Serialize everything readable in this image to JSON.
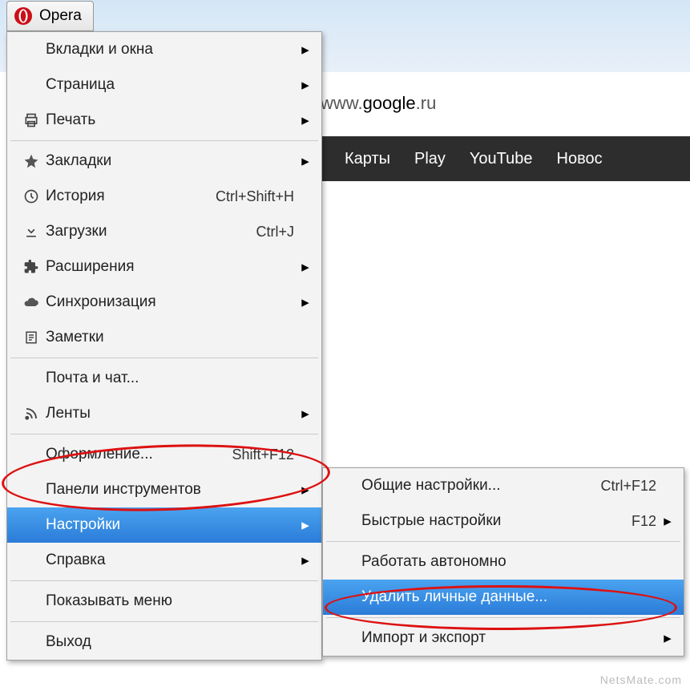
{
  "app": {
    "name": "Opera"
  },
  "address": {
    "prefix": "www.",
    "domain": "google",
    "suffix": ".ru"
  },
  "nav": {
    "items": [
      "Карты",
      "Play",
      "YouTube",
      "Новос"
    ]
  },
  "mainMenu": {
    "items": [
      {
        "icon": "",
        "label": "Вкладки и окна",
        "shortcut": "",
        "arrow": true
      },
      {
        "icon": "",
        "label": "Страница",
        "shortcut": "",
        "arrow": true
      },
      {
        "icon": "printer",
        "label": "Печать",
        "shortcut": "",
        "arrow": true
      },
      {
        "sep": true
      },
      {
        "icon": "star",
        "label": "Закладки",
        "shortcut": "",
        "arrow": true
      },
      {
        "icon": "clock",
        "label": "История",
        "shortcut": "Ctrl+Shift+H",
        "arrow": false
      },
      {
        "icon": "download",
        "label": "Загрузки",
        "shortcut": "Ctrl+J",
        "arrow": false
      },
      {
        "icon": "puzzle",
        "label": "Расширения",
        "shortcut": "",
        "arrow": true
      },
      {
        "icon": "cloud",
        "label": "Синхронизация",
        "shortcut": "",
        "arrow": true
      },
      {
        "icon": "note",
        "label": "Заметки",
        "shortcut": "",
        "arrow": false
      },
      {
        "sep": true
      },
      {
        "icon": "",
        "label": "Почта и чат...",
        "shortcut": "",
        "arrow": false
      },
      {
        "icon": "feed",
        "label": "Ленты",
        "shortcut": "",
        "arrow": true
      },
      {
        "sep": true
      },
      {
        "icon": "",
        "label": "Оформление...",
        "shortcut": "Shift+F12",
        "arrow": false
      },
      {
        "icon": "",
        "label": "Панели инструментов",
        "shortcut": "",
        "arrow": true
      },
      {
        "icon": "",
        "label": "Настройки",
        "shortcut": "",
        "arrow": true,
        "highlighted": true
      },
      {
        "icon": "",
        "label": "Справка",
        "shortcut": "",
        "arrow": true
      },
      {
        "sep": true
      },
      {
        "icon": "",
        "label": "Показывать меню",
        "shortcut": "",
        "arrow": false
      },
      {
        "sep": true
      },
      {
        "icon": "",
        "label": "Выход",
        "shortcut": "",
        "arrow": false
      }
    ]
  },
  "subMenu": {
    "items": [
      {
        "label": "Общие настройки...",
        "shortcut": "Ctrl+F12",
        "arrow": false
      },
      {
        "label": "Быстрые настройки",
        "shortcut": "F12",
        "arrow": true
      },
      {
        "sep": true
      },
      {
        "label": "Работать автономно",
        "shortcut": "",
        "arrow": false
      },
      {
        "label": "Удалить личные данные...",
        "shortcut": "",
        "arrow": false,
        "highlighted": true
      },
      {
        "sep": true
      },
      {
        "label": "Импорт и экспорт",
        "shortcut": "",
        "arrow": true
      }
    ]
  },
  "watermark": "NetsMate.com"
}
